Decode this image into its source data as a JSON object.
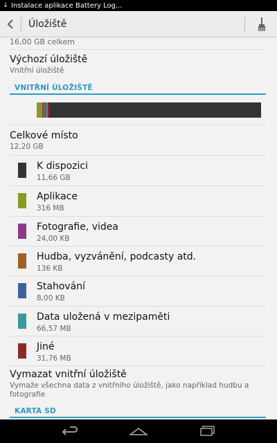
{
  "statusbar": {
    "notification": "Instalace aplikace Battery Log..."
  },
  "actionbar": {
    "title": "Úložiště"
  },
  "storage": {
    "total_text": "16,00 GB celkem",
    "default_title": "Výchozí úložiště",
    "default_value": "Vnitřní úložiště",
    "internal_header": "VNITŘNÍ ÚLOŽIŠTĚ",
    "total_space_title": "Celkové místo",
    "total_space_value": "12,20 GB",
    "categories": [
      {
        "label": "K dispozici",
        "value": "11,66 GB",
        "color": "#333333"
      },
      {
        "label": "Aplikace",
        "value": "316 MB",
        "color": "#8a9a22"
      },
      {
        "label": "Fotografie, videa",
        "value": "24,00 KB",
        "color": "#8a3a8a"
      },
      {
        "label": "Hudba, vyzvánění, podcasty atd.",
        "value": "136 KB",
        "color": "#a0602a"
      },
      {
        "label": "Stahování",
        "value": "8,00 KB",
        "color": "#3f5fa0"
      },
      {
        "label": "Data uložená v mezipaměti",
        "value": "66,57 MB",
        "color": "#3a9a9a"
      },
      {
        "label": "Jiné",
        "value": "31,76 MB",
        "color": "#8a2a2a"
      }
    ],
    "erase_title": "Vymazat vnitřní úložiště",
    "erase_desc": "Vymaže všechna data z vnitřního úložiště, jako například hudbu a fotografie",
    "sd_header": "KARTA SD"
  },
  "usage_bar": {
    "segments": [
      {
        "name": "apps",
        "fraction": 0.025,
        "color": "#8a9a22"
      },
      {
        "name": "photos",
        "fraction": 0.006,
        "color": "#8a3a8a"
      },
      {
        "name": "music",
        "fraction": 0.006,
        "color": "#a0602a"
      },
      {
        "name": "downloads",
        "fraction": 0.006,
        "color": "#3f5fa0"
      },
      {
        "name": "cache",
        "fraction": 0.006,
        "color": "#3a9a9a"
      },
      {
        "name": "other",
        "fraction": 0.006,
        "color": "#8a2a2a"
      },
      {
        "name": "available",
        "fraction": 0.945,
        "color": "#333333"
      }
    ]
  }
}
